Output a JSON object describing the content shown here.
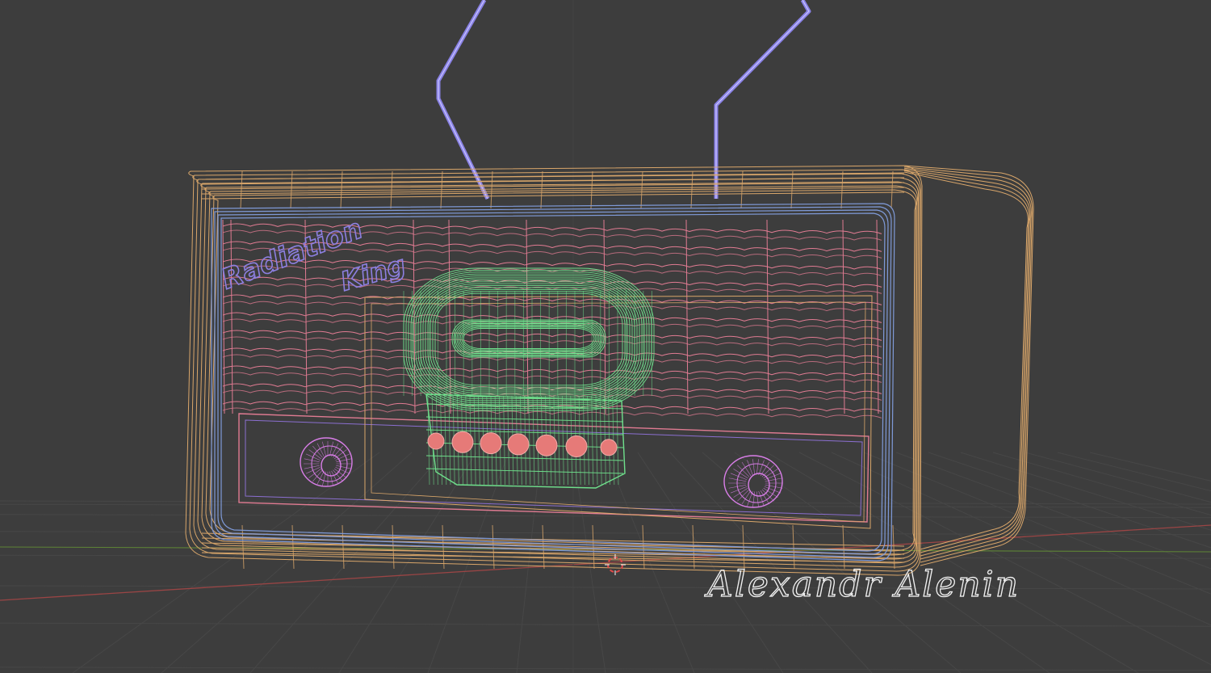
{
  "viewport": {
    "background": "#3d3d3d",
    "grid_color": "#474747",
    "x_axis_color": "#a84a4a",
    "y_axis_color": "#6a8f3a"
  },
  "model": {
    "brand_line1": "Radiation",
    "brand_line2": "King",
    "signature": "Alexandr Alenin",
    "colors": {
      "cabinet": "#d9a66a",
      "inner_frame": "#7f9ad8",
      "grille": "#e07b92",
      "dial": "#6fe08c",
      "knobs": "#d97ee8",
      "antenna": "#8a82e6",
      "brand": "#8c7fe0",
      "buttons": "#e67a78"
    }
  },
  "icons": {
    "cursor": "3d-cursor-icon"
  }
}
